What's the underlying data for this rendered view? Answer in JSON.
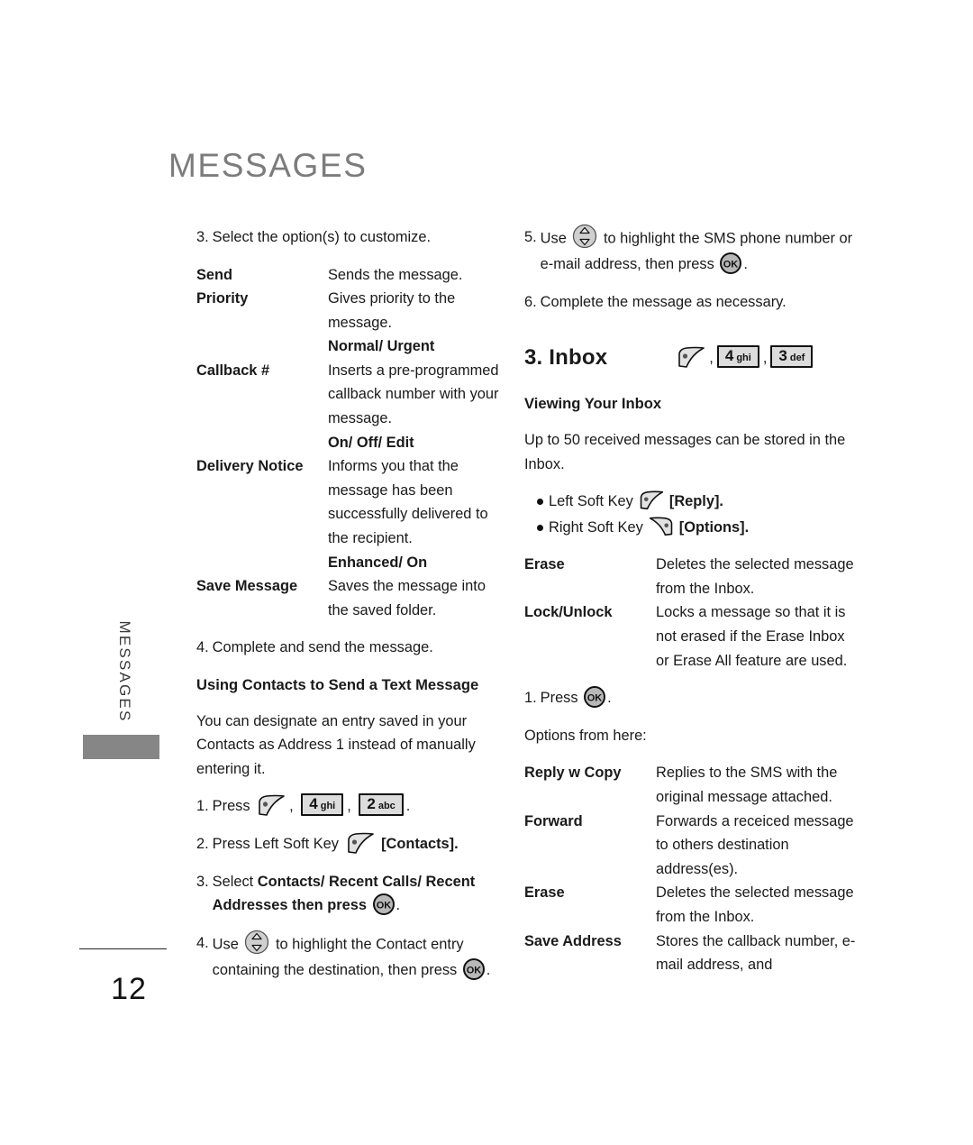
{
  "document": {
    "chapter_title": "MESSAGES",
    "side_tab_label": "MESSAGES",
    "page_number": "12",
    "colors": {
      "chapter_title": "#7c7c7c",
      "side_bar": "#868686",
      "key_fill": "#dcdcdc",
      "text": "#1a1a1a"
    }
  },
  "left_column": {
    "step3": {
      "num": "3.",
      "text": "Select the option(s) to customize."
    },
    "options": [
      {
        "term": "Send",
        "desc": "Sends the message.",
        "values": ""
      },
      {
        "term": "Priority",
        "desc": "Gives priority to the message.",
        "values": "Normal/ Urgent"
      },
      {
        "term": "Callback #",
        "desc": "Inserts a pre-programmed callback number with your message.",
        "values": "On/ Off/ Edit"
      },
      {
        "term": "Delivery Notice",
        "desc": "Informs you that the message has been successfully delivered to the recipient.",
        "values": "Enhanced/ On"
      },
      {
        "term": "Save Message",
        "desc": "Saves the message into the saved folder.",
        "values": ""
      }
    ],
    "step4": {
      "num": "4.",
      "text": "Complete and send the message."
    },
    "heading": "Using Contacts to Send a Text Message",
    "intro": "You can designate an entry saved in your Contacts as Address 1 instead of manually entering it.",
    "press_step": {
      "num": "1.",
      "label": "Press",
      "keys": [
        {
          "type": "soft-left"
        },
        {
          "type": "keycap",
          "number": "4",
          "letters": "ghi"
        },
        {
          "type": "keycap",
          "number": "2",
          "letters": "abc"
        }
      ],
      "trailing": "."
    },
    "softkey_step": {
      "num": "2.",
      "pre": "Press Left Soft Key",
      "post": "[Contacts]."
    },
    "select_step": {
      "num": "3.",
      "pre": "Select ",
      "bold": "Contacts/ Recent Calls/ Recent Addresses",
      "mid": " then press ",
      "post": "."
    },
    "use_step": {
      "num": "4.",
      "pre": "Use",
      "mid": "to highlight the Contact entry containing the destination, then press",
      "post": "."
    }
  },
  "right_column": {
    "step5": {
      "num": "5.",
      "pre": "Use",
      "mid": "to highlight the SMS phone number or e-mail address, then press",
      "post": "."
    },
    "step6": {
      "num": "6.",
      "text": "Complete the message as necessary."
    },
    "inbox": {
      "title": "3. Inbox",
      "keys": [
        {
          "type": "soft-left"
        },
        {
          "type": "keycap",
          "number": "4",
          "letters": "ghi"
        },
        {
          "type": "keycap",
          "number": "3",
          "letters": "def"
        }
      ]
    },
    "viewing_heading": "Viewing Your Inbox",
    "viewing_body": "Up to 50 received messages can be stored in the Inbox.",
    "softkeys": [
      {
        "label": "Left Soft Key",
        "icon": "soft-left",
        "action": "[Reply]."
      },
      {
        "label": "Right Soft Key",
        "icon": "soft-right",
        "action": "[Options]."
      }
    ],
    "inbox_options": [
      {
        "term": "Erase",
        "desc": "Deletes the selected message from the Inbox."
      },
      {
        "term": "Lock/Unlock",
        "desc": "Locks a message so that it is not erased if the Erase Inbox or Erase All feature are used."
      }
    ],
    "press_ok_step": {
      "num": "1.",
      "label": "Press",
      "trailing": "."
    },
    "options_from_here": "Options from here:",
    "options_list": [
      {
        "term": "Reply w Copy",
        "desc": "Replies to the SMS with the original message attached."
      },
      {
        "term": "Forward",
        "desc": "Forwards a receiced message to others destination address(es)."
      },
      {
        "term": "Erase",
        "desc": "Deletes the selected message from the Inbox."
      },
      {
        "term": "Save Address",
        "desc": "Stores the callback number, e-mail address, and"
      }
    ]
  }
}
